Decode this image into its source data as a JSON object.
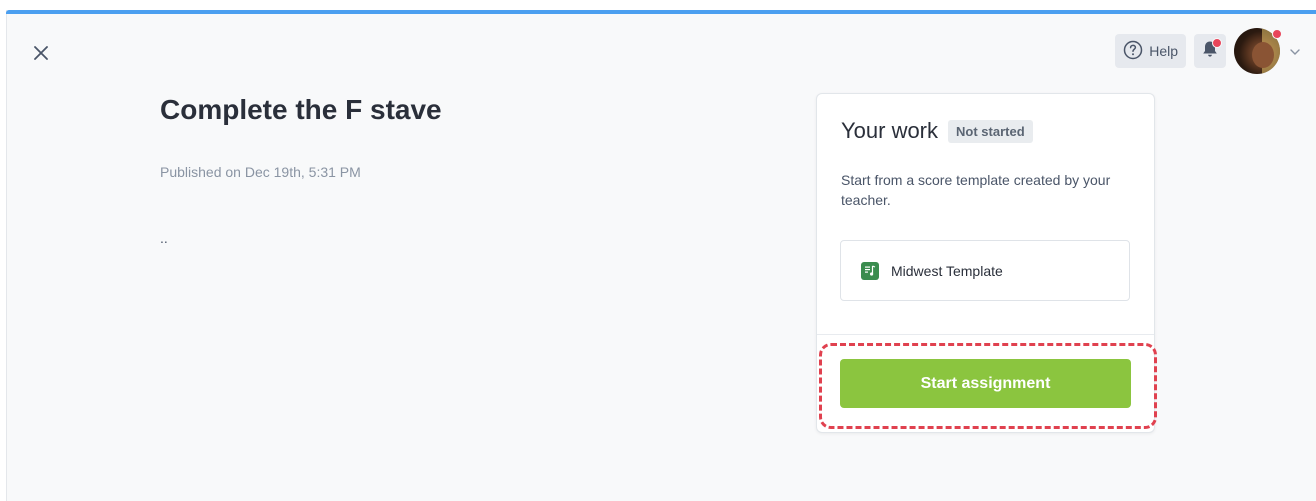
{
  "header": {
    "help_label": "Help",
    "icons": {
      "close": "close-icon",
      "help": "question-circle-icon",
      "bell": "bell-icon",
      "chevron": "chevron-down-icon"
    },
    "notification_color": "#e8455a"
  },
  "assignment": {
    "title": "Complete the F stave",
    "published": "Published on Dec 19th, 5:31 PM",
    "description": ".."
  },
  "work_card": {
    "title": "Your work",
    "status": "Not started",
    "description": "Start from a score template created by your teacher.",
    "template_label": "Midwest Template",
    "start_button_label": "Start assignment"
  },
  "colors": {
    "accent_bar": "#4b9ff0",
    "start_button": "#8bc53f",
    "template_icon": "#3a8c4e",
    "highlight": "#e0414f"
  }
}
